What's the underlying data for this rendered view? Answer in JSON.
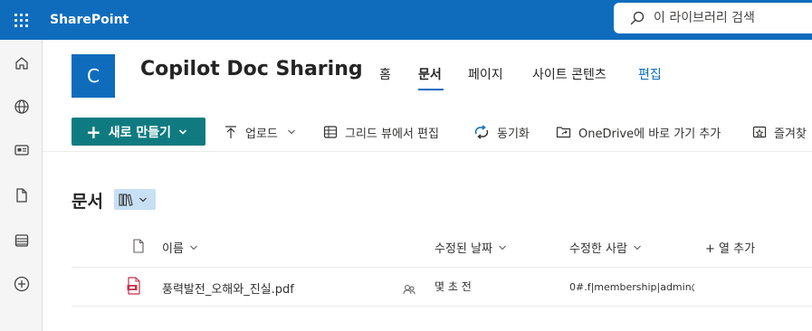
{
  "suitebar": {
    "app_name": "SharePoint",
    "search_placeholder": "이 라이브러리 검색"
  },
  "leftrail": {
    "items": [
      "home-icon",
      "globe-icon",
      "news-icon",
      "file-icon",
      "list-icon",
      "add-icon"
    ]
  },
  "site": {
    "logo_letter": "C",
    "title": "Copilot Doc Sharing",
    "nav": [
      "홈",
      "문서",
      "페이지",
      "사이트 콘텐츠",
      "편집"
    ],
    "active_nav": "문서"
  },
  "commandbar": {
    "new_label": "새로 만들기",
    "upload_label": "업로드",
    "grid_edit_label": "그리드 뷰에서 편집",
    "sync_label": "동기화",
    "onedrive_label": "OneDrive에 바로 가기 추가",
    "favorites_label": "즐겨찾"
  },
  "library": {
    "title": "문서",
    "columns": {
      "name": "이름",
      "modified": "수정된 날짜",
      "modified_by": "수정한 사람",
      "add_column": "+ 열 추가"
    },
    "rows": [
      {
        "name": "풍력발전_오해와_진실.pdf",
        "modified": "몇 초 전",
        "modified_by": "0#.f|membership|admin@"
      }
    ]
  },
  "colors": {
    "suitebar": "#0f6cbd",
    "new_button": "#0f7b80",
    "view_switch": "#c7e0f4",
    "pdf_icon": "#c4314b"
  }
}
